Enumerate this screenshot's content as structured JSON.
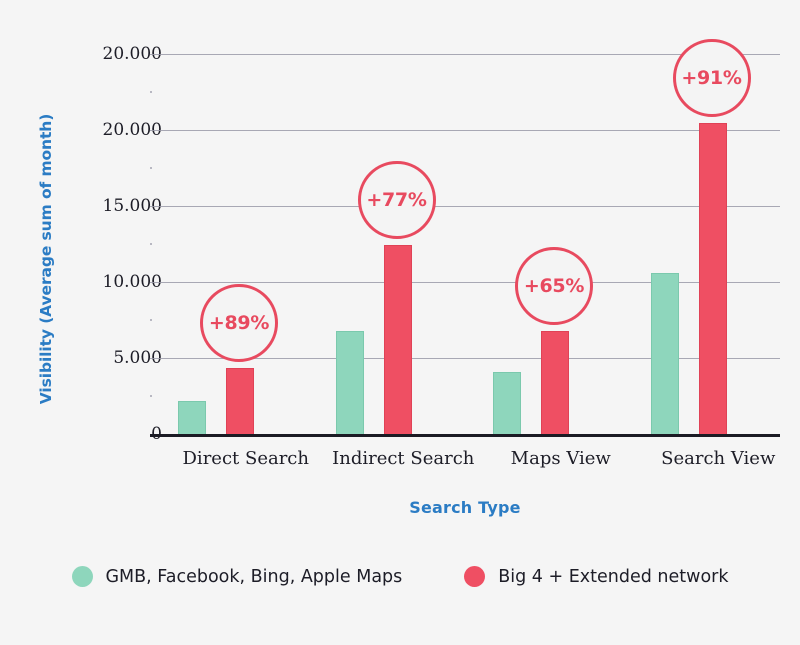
{
  "chart_data": {
    "type": "bar",
    "title": "",
    "xlabel": "Search Type",
    "ylabel": "Visibility (Average sum of month)",
    "categories": [
      "Direct Search",
      "Indirect Search",
      "Maps View",
      "Search View"
    ],
    "series": [
      {
        "name": "GMB, Facebook, Bing, Apple Maps",
        "color": "#8ed6bc",
        "values": [
          2100,
          6700,
          4000,
          10500
        ]
      },
      {
        "name": "Big 4 + Extended network",
        "color": "#ef4f63",
        "values": [
          4300,
          12400,
          6700,
          20400
        ]
      }
    ],
    "ylim": [
      0,
      25000
    ],
    "y_ticks": [
      0,
      5000,
      10000,
      15000,
      20000,
      25000
    ],
    "y_tick_labels": [
      "0",
      "5.000",
      "10.000",
      "15.000",
      "20.000",
      "20.000"
    ],
    "grid": true,
    "legend_position": "bottom",
    "annotations": [
      {
        "label": "+89%",
        "category": "Direct Search"
      },
      {
        "label": "+77%",
        "category": "Indirect Search"
      },
      {
        "label": "+65%",
        "category": "Maps View"
      },
      {
        "label": "+91%",
        "category": "Search View"
      }
    ],
    "colors": {
      "series_a": "#8ed6bc",
      "series_b": "#ef4f63",
      "axis_title": "#2b7cc4",
      "annotation": "#e84a5f",
      "background": "#f5f5f5",
      "gridline": "#9a9aa8",
      "baseline": "#1b1b24"
    }
  }
}
